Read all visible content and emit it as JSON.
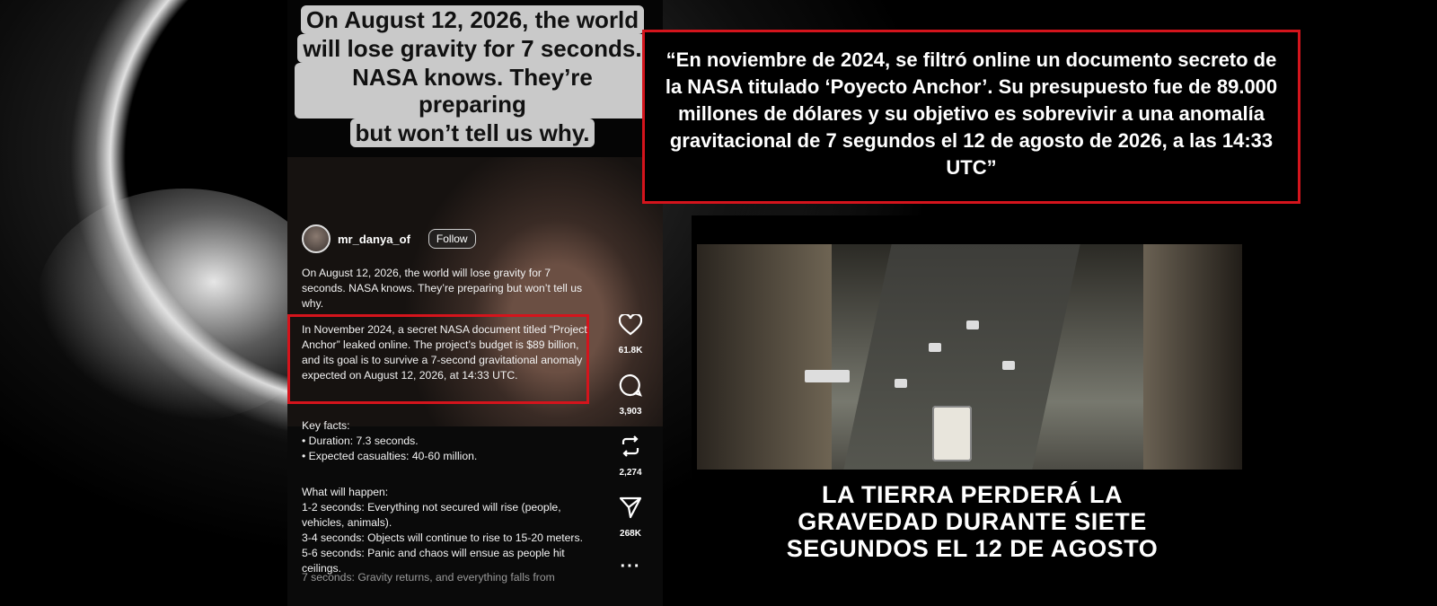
{
  "overlay": {
    "lines": [
      "On August 12, 2026, the world",
      "will lose gravity for 7 seconds.",
      "NASA knows. They’re preparing",
      "but won’t tell us why."
    ]
  },
  "post": {
    "username": "mr_danya_of",
    "follow_label": "Follow",
    "intro": "On August 12, 2026, the world will lose gravity for 7 seconds. NASA knows. They’re preparing but won’t tell us why.",
    "highlighted": "In November 2024, a secret NASA document titled “Project Anchor” leaked online. The project’s budget is $89 billion, and its goal is to survive a 7-second gravitational anomaly expected on August 12, 2026, at 14:33 UTC.",
    "key_facts_title": "Key facts:",
    "key_facts": [
      "• Duration: 7.3 seconds.",
      "• Expected casualties: 40-60 million."
    ],
    "happen_title": "What will happen:",
    "happen": [
      "1-2 seconds: Everything not secured will rise (people, vehicles, animals).",
      "3-4 seconds: Objects will continue to rise to 15-20 meters.",
      "5-6 seconds: Panic and chaos will ensue as people hit ceilings."
    ],
    "faded": "7 seconds: Gravity returns, and everything falls from"
  },
  "actions": {
    "likes": "61.8K",
    "comments": "3,903",
    "reposts": "2,274",
    "shares": "268K",
    "more": "···"
  },
  "quote": "“En noviembre de 2024, se filtró online un documento secreto de la NASA titulado ‘Poyecto Anchor’. Su presupuesto fue de 89.000 millones de dólares y su objetivo es sobrevivir a una anomalía gravitacional de 7 segundos el 12 de agosto de 2026, a las 14:33 UTC”",
  "news": {
    "caption": [
      "LA TIERRA PERDERÁ LA",
      "GRAVEDAD DURANTE SIETE",
      "SEGUNDOS EL 12 DE AGOSTO"
    ]
  },
  "colors": {
    "highlight": "#d4141c"
  }
}
